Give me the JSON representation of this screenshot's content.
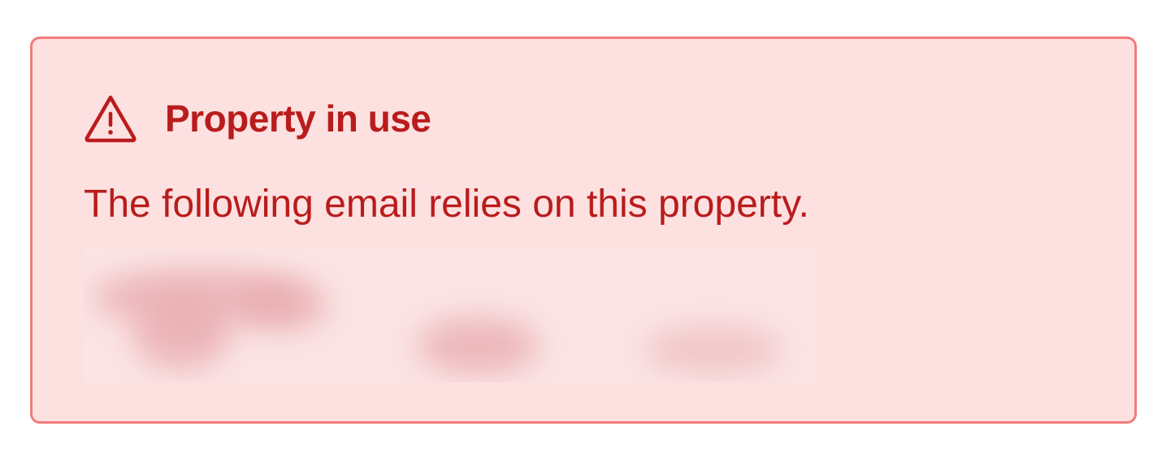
{
  "alert": {
    "variant": "danger",
    "icon": "warning-triangle-icon",
    "title": "Property in use",
    "message": "The following email relies on this property.",
    "colors": {
      "text": "#b91c1c",
      "background": "#fde0e0",
      "border": "#f27b7b"
    }
  }
}
